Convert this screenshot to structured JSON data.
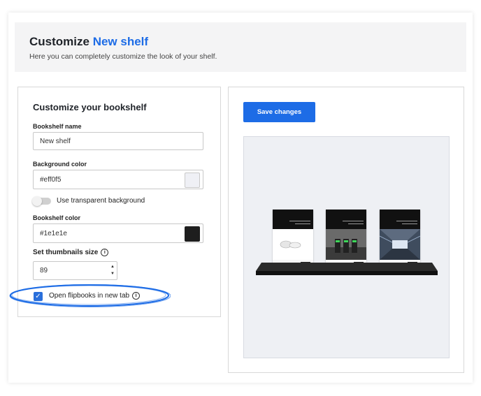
{
  "header": {
    "title_prefix": "Customize",
    "title_accent": "New shelf",
    "subtitle": "Here you can completely customize the look of your shelf."
  },
  "left": {
    "title": "Customize your bookshelf",
    "name_label": "Bookshelf name",
    "name_value": "New shelf",
    "bg_label": "Background color",
    "bg_value": "#eff0f5",
    "transparent_label": "Use transparent background",
    "shelf_color_label": "Bookshelf color",
    "shelf_color_value": "#1e1e1e",
    "thumb_label": "Set thumbnails size",
    "thumb_value": "89",
    "open_new_tab_label": "Open flipbooks in new tab"
  },
  "right": {
    "save_label": "Save changes"
  },
  "colors": {
    "accent": "#1d6ce6",
    "background_swatch": "#eff0f5",
    "shelf_swatch": "#1e1e1e"
  }
}
